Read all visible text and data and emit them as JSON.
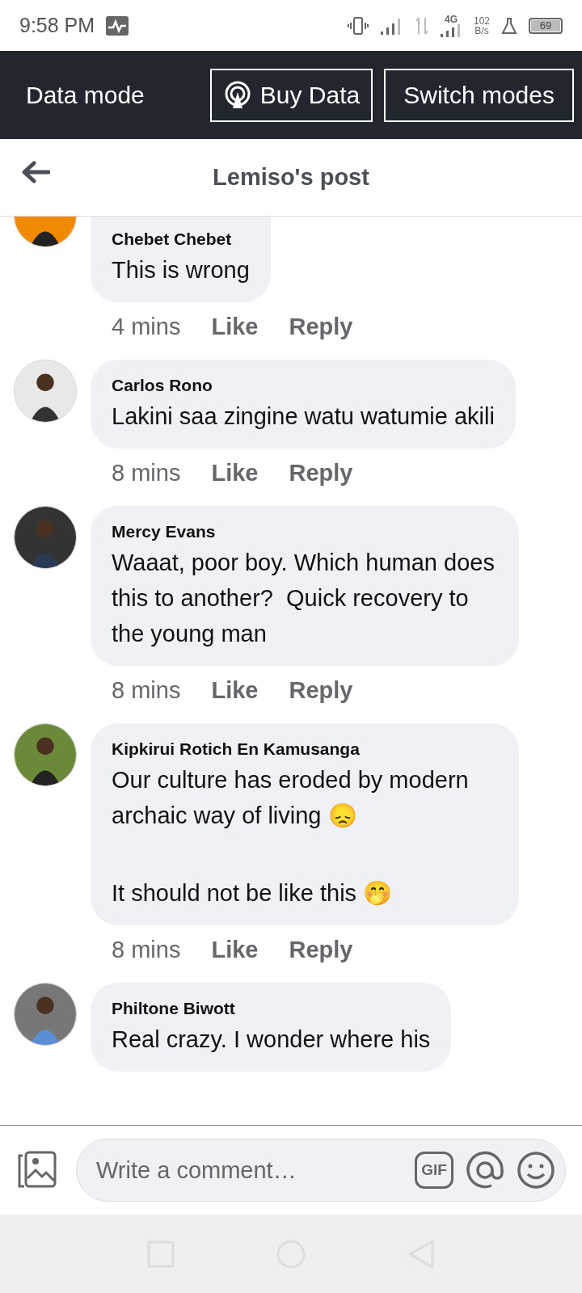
{
  "status_bar": {
    "time": "9:58 PM",
    "network_type": "4G",
    "speed_value": "102",
    "speed_unit": "B/s",
    "battery": "69"
  },
  "data_bar": {
    "label": "Data mode",
    "buttons": [
      {
        "label": "Buy Data",
        "kind": "buy"
      },
      {
        "label": "Switch modes",
        "kind": "plain"
      }
    ]
  },
  "header": {
    "title": "Lemiso's post"
  },
  "comments": [
    {
      "author": "Chebet Chebet",
      "paragraphs": [
        "This is wrong"
      ],
      "time": "4 mins",
      "actions": [
        "Like",
        "Reply"
      ]
    },
    {
      "author": "Carlos Rono",
      "paragraphs": [
        "Lakini saa zingine watu watumie akili"
      ],
      "time": "8 mins",
      "actions": [
        "Like",
        "Reply"
      ]
    },
    {
      "author": "Mercy Evans",
      "paragraphs": [
        "Waaat, poor boy. Which human does this to another?  Quick recovery to the young man"
      ],
      "time": "8 mins",
      "actions": [
        "Like",
        "Reply"
      ]
    },
    {
      "author": "Kipkirui Rotich En Kamusanga",
      "paragraphs": [
        "Our culture has eroded by modern archaic way of living 😞",
        "It should not be like this 🤭"
      ],
      "time": "8 mins",
      "actions": [
        "Like",
        "Reply"
      ]
    },
    {
      "author": "Philtone Biwott",
      "paragraphs": [
        "Real crazy. I wonder where his"
      ]
    }
  ],
  "composer": {
    "placeholder": "Write a comment…",
    "gif_label": "GIF"
  }
}
